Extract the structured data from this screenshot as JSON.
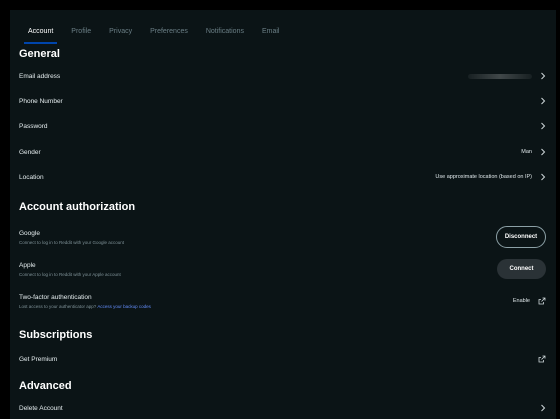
{
  "tabs": [
    "Account",
    "Profile",
    "Privacy",
    "Preferences",
    "Notifications",
    "Email"
  ],
  "sections": {
    "general": "General",
    "authorization": "Account authorization",
    "subscriptions": "Subscriptions",
    "advanced": "Advanced"
  },
  "general": {
    "email_label": "Email address",
    "phone_label": "Phone Number",
    "password_label": "Password",
    "gender_label": "Gender",
    "gender_value": "Man",
    "location_label": "Location",
    "location_value": "Use approximate location (based on IP)"
  },
  "authorization": {
    "google_title": "Google",
    "google_desc": "Connect to log in to Reddit with your Google account",
    "google_button": "Disconnect",
    "apple_title": "Apple",
    "apple_desc": "Connect to log in to Reddit with your Apple account",
    "apple_button": "Connect",
    "twofa_title": "Two-factor authentication",
    "twofa_desc": "Lost access to your authenticator app?",
    "twofa_link": "Access your backup codes",
    "twofa_action": "Enable"
  },
  "subscriptions": {
    "premium_label": "Get Premium"
  },
  "advanced": {
    "delete_label": "Delete Account"
  },
  "colors": {
    "background": "#0b1416",
    "accent": "#0045ac",
    "link": "#648efc"
  }
}
